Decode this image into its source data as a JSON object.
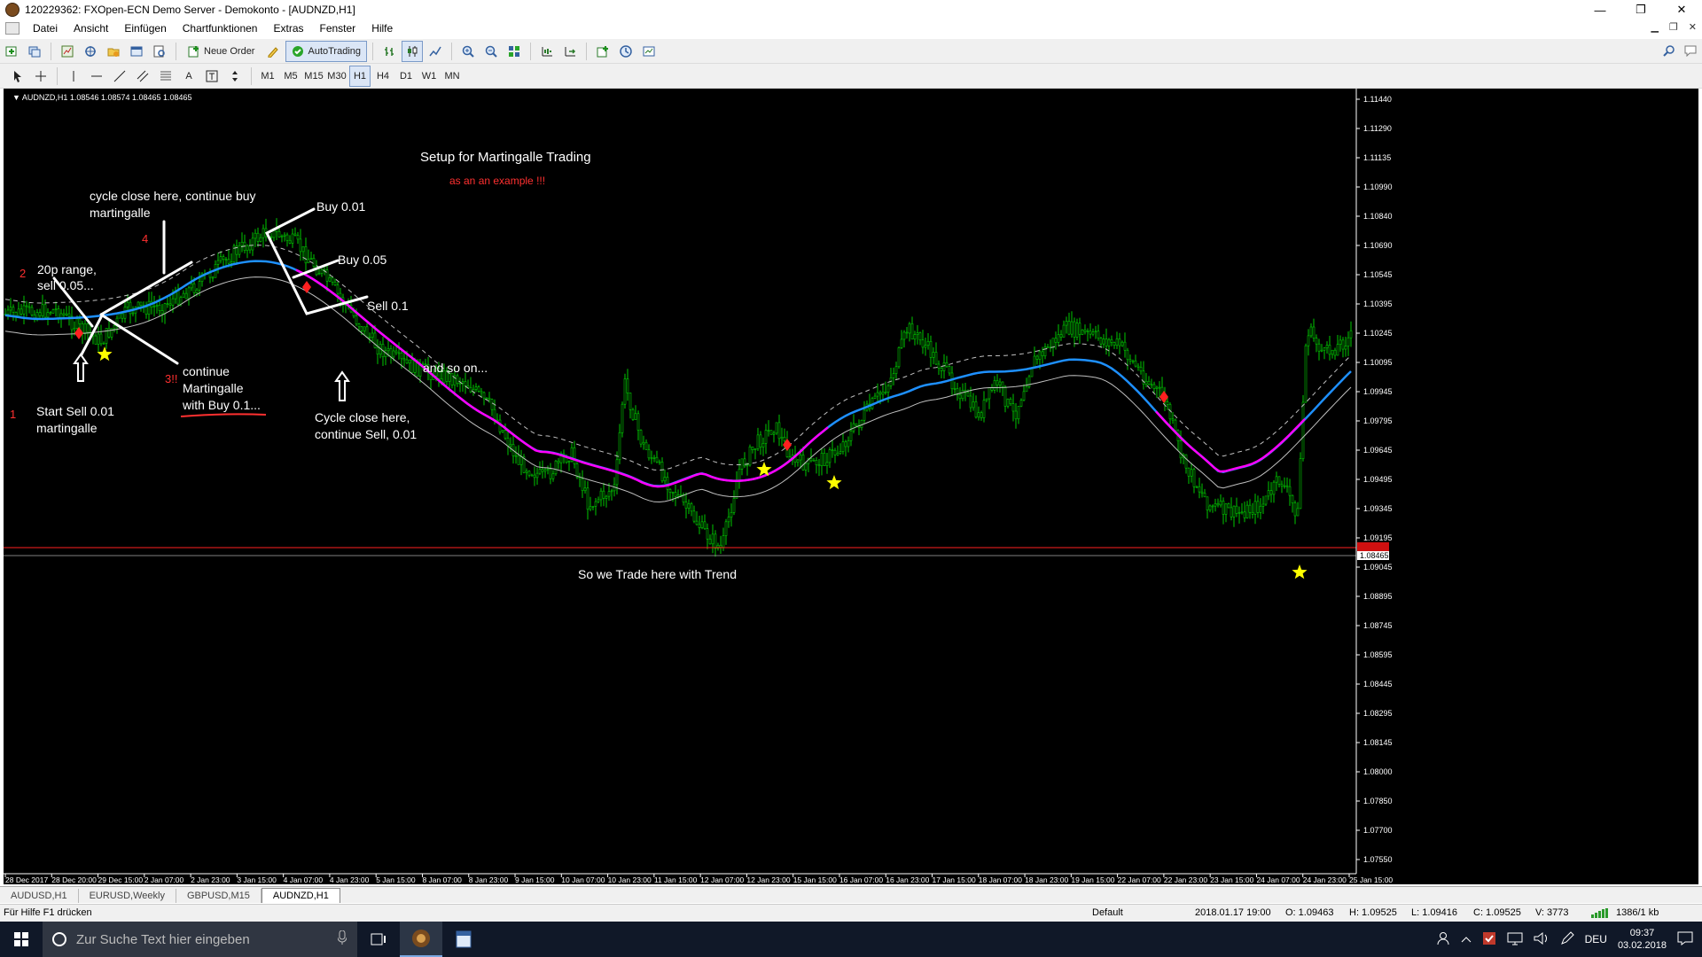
{
  "window": {
    "title": "120229362: FXOpen-ECN Demo Server - Demokonto - [AUDNZD,H1]",
    "controls": [
      "—",
      "❐",
      "✕"
    ]
  },
  "menu": [
    "Datei",
    "Ansicht",
    "Einfügen",
    "Chartfunktionen",
    "Extras",
    "Fenster",
    "Hilfe"
  ],
  "toolbar": {
    "new_order": "Neue Order",
    "autotrading": "AutoTrading",
    "timeframes": [
      "M1",
      "M5",
      "M15",
      "M30",
      "H1",
      "H4",
      "D1",
      "W1",
      "MN"
    ],
    "active_timeframe": "H1",
    "text_tool": "A"
  },
  "chart": {
    "header": "AUDNZD,H1  1.08546 1.08574 1.08465 1.08465",
    "price_axis": [
      "1.11440",
      "1.11290",
      "1.11135",
      "1.10990",
      "1.10840",
      "1.10690",
      "1.10545",
      "1.10395",
      "1.10245",
      "1.10095",
      "1.09945",
      "1.09795",
      "1.09645",
      "1.09495",
      "1.09345",
      "1.09195",
      "1.09045",
      "1.08895",
      "1.08745",
      "1.08595",
      "1.08445",
      "1.08295",
      "1.08145",
      "1.08000",
      "1.07850",
      "1.07700",
      "1.07550"
    ],
    "current_price_label": "1.08465",
    "time_axis": [
      "28 Dec 2017",
      "28 Dec 20:00",
      "29 Dec 15:00",
      "2 Jan 07:00",
      "2 Jan 23:00",
      "3 Jan 15:00",
      "4 Jan 07:00",
      "4 Jan 23:00",
      "5 Jan 15:00",
      "8 Jan 07:00",
      "8 Jan 23:00",
      "9 Jan 15:00",
      "10 Jan 07:00",
      "10 Jan 23:00",
      "11 Jan 15:00",
      "12 Jan 07:00",
      "12 Jan 23:00",
      "15 Jan 15:00",
      "16 Jan 07:00",
      "16 Jan 23:00",
      "17 Jan 15:00",
      "18 Jan 07:00",
      "18 Jan 23:00",
      "19 Jan 15:00",
      "22 Jan 07:00",
      "22 Jan 23:00",
      "23 Jan 15:00",
      "24 Jan 07:00",
      "24 Jan 23:00",
      "25 Jan 15:00"
    ],
    "colors": {
      "background": "#000000",
      "bull": "#00c800",
      "bear": "#00c800",
      "ma_blue": "#1e90ff",
      "ma_magenta": "#ff00ff",
      "envelope": "#c0c0c0",
      "price_line": "#ff2020",
      "annotation_white": "#ffffff",
      "annotation_red": "#ff3030",
      "star": "#ffff00"
    },
    "annotations": {
      "title": "Setup for Martingalle Trading",
      "subtitle": "as an an example !!!",
      "cycle_buy": "cycle close here, continue buy",
      "cycle_buy2": "martingalle",
      "num4": "4",
      "num2": "2",
      "range": "20p range,",
      "range2": "sell 0.05...",
      "buy001": "Buy 0.01",
      "buy005": "Buy 0.05",
      "sell01": "Sell 0.1",
      "num1": "1",
      "start": "Start Sell 0.01",
      "start2": "martingalle",
      "num3": "3!!",
      "cont": "continue",
      "cont2": "Martingalle",
      "cont3": "with   Buy 0.1...",
      "and_so_on": "and so on...",
      "cycle_sell": "Cycle close here,",
      "cycle_sell2": "continue Sell, 0.01",
      "trend": "So we Trade here with Trend"
    }
  },
  "tabs": [
    "AUDUSD,H1",
    "EURUSD,Weekly",
    "GBPUSD,M15",
    "AUDNZD,H1"
  ],
  "active_tab": "AUDNZD,H1",
  "status": {
    "help": "Für Hilfe F1 drücken",
    "profile": "Default",
    "datetime": "2018.01.17 19:00",
    "open": "O: 1.09463",
    "high": "H: 1.09525",
    "low": "L: 1.09416",
    "close": "C: 1.09525",
    "volume": "V: 3773",
    "traffic": "1386/1 kb"
  },
  "taskbar": {
    "search_placeholder": "Zur Suche Text hier eingeben",
    "lang": "DEU",
    "time": "09:37",
    "date": "03.02.2018"
  }
}
